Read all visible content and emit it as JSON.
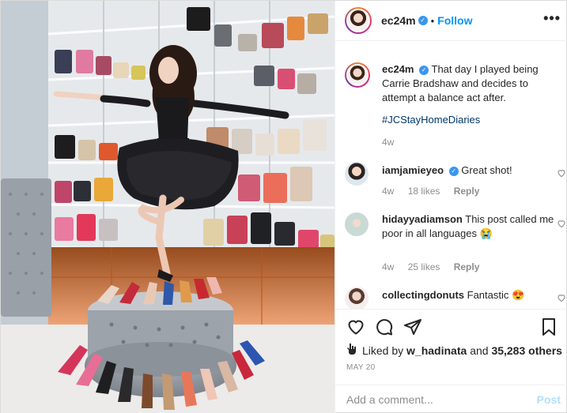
{
  "post": {
    "username": "ec24m",
    "verified_mark": "✓",
    "separator": "•",
    "follow_label": "Follow",
    "more_icon": "more-options-icon",
    "photo_description_icon": "photo"
  },
  "caption": {
    "username": "ec24m",
    "text": "That day I played being Carrie Bradshaw and decides to attempt a balance act after.",
    "hashtag": "#JCStayHomeDiaries",
    "time": "4w"
  },
  "comments": [
    {
      "username": "iamjamieyeo",
      "verified": true,
      "text": "Great shot!",
      "time": "4w",
      "likes": "18 likes",
      "reply": "Reply"
    },
    {
      "username": "hidayyadiamson",
      "verified": false,
      "text": "This post called me poor in all languages 😭",
      "time": "4w",
      "likes": "25 likes",
      "reply": "Reply"
    },
    {
      "username": "collectingdonuts",
      "verified": false,
      "text": "Fantastic 😍",
      "time": "",
      "likes": "",
      "reply": ""
    }
  ],
  "actions": {
    "liked_by_prefix": "Liked by",
    "liked_by_user": "w_hadinata",
    "liked_by_and": "and",
    "likes_count": "35,283 others",
    "date": "MAY 20"
  },
  "add_comment": {
    "placeholder": "Add a comment...",
    "post_label": "Post"
  },
  "colors": {
    "accent": "#0095f6",
    "verified": "#3897f0",
    "meta_gray": "#8e8e8e"
  }
}
